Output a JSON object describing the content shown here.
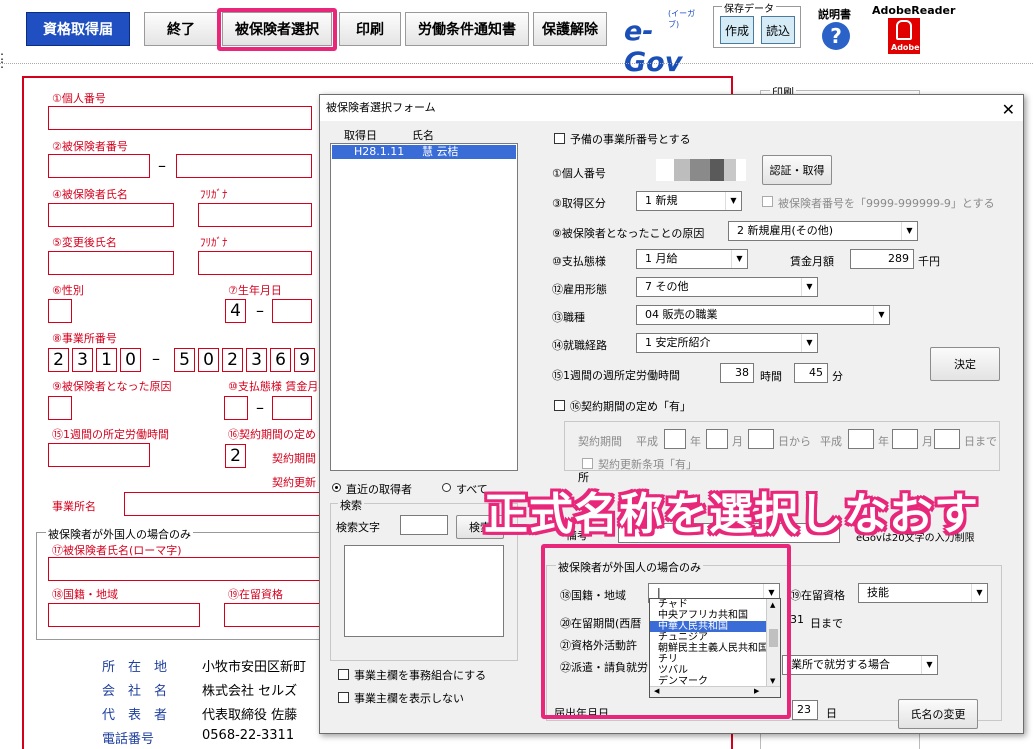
{
  "toolbar": {
    "shikaku": "資格取得届",
    "end": "終了",
    "select_insured": "被保険者選択",
    "print": "印刷",
    "labor_notice": "労働条件通知書",
    "unprotect": "保護解除",
    "egov": "e-Gov",
    "egov_ruby": "(イーガブ)",
    "save_data": "保存データ",
    "create": "作成",
    "read": "読込",
    "manual": "説明書",
    "adobe_reader": "AdobeReader",
    "adobe": "Adobe"
  },
  "form": {
    "l1": "①個人番号",
    "l2": "②被保険者番号",
    "l4": "④被保険者氏名",
    "furigana1": "ﾌﾘｶﾞﾅ",
    "l5": "⑤変更後氏名",
    "furigana2": "ﾌﾘｶﾞﾅ",
    "l6": "⑥性別",
    "l7": "⑦生年月日",
    "birth_era": "4",
    "l8": "⑧事業所番号",
    "office_digits": [
      "2",
      "3",
      "1",
      "0",
      "5",
      "0",
      "2",
      "3",
      "6",
      "9"
    ],
    "l9": "⑨被保険者となった原因",
    "l10": "⑩支払態様 賃金月額",
    "l15": "⑮1週間の所定労働時間",
    "l16": "⑯契約期間の定め",
    "contract_val": "2",
    "contract_period": "契約期間",
    "contract_renew": "契約更新",
    "office_name": "事業所名",
    "foreign_group": "被保険者が外国人の場合のみ",
    "l17": "⑰被保険者氏名(ローマ字)",
    "l18": "⑱国籍・地域",
    "l19": "⑲在留資格",
    "print_group": "印刷",
    "addr_label": "所　在　地",
    "addr_value": "小牧市安田区新町",
    "company_label": "会　社　名",
    "company_value": "株式会社 セルズ",
    "rep_label": "代　表　者",
    "rep_value": "代表取締役 佐藤",
    "tel_label": "電話番号",
    "tel_value": "0568-22-3311"
  },
  "dialog": {
    "title": "被保険者選択フォーム",
    "close": "✕",
    "col_date": "取得日",
    "col_name": "氏名",
    "list_row_date": "H28.1.11",
    "list_row_name": "慧 云桔",
    "radio_recent": "直近の取得者",
    "radio_all": "すべて",
    "search_group": "検索",
    "search_label": "検索文字",
    "search_btn": "検索",
    "chk_union": "事業主欄を事務組合にする",
    "chk_hide": "事業主欄を表示しない",
    "spare_office": "予備の事業所番号とする",
    "f1": "①個人番号",
    "auth_btn": "認証・取得",
    "f3": "③取得区分",
    "f3_val": "1  新規",
    "insured_num_chk": "被保険者番号を「9999-999999-9」とする",
    "f9": "⑨被保険者となったことの原因",
    "f9_val": "2  新規雇用(その他)",
    "f10": "⑩支払態様",
    "f10_val": "1  月給",
    "wage_label": "賃金月額",
    "wage_val": "289",
    "wage_unit": "千円",
    "f12": "⑫雇用形態",
    "f12_val": "7  その他",
    "f13": "⑬職種",
    "f13_val": "04  販売の職業",
    "f14": "⑭就職経路",
    "f14_val": "1  安定所紹介",
    "f15": "⑮1週間の週所定労働時間",
    "hours_val": "38",
    "hours_unit": "時間",
    "min_val": "45",
    "min_unit": "分",
    "decide_btn": "決定",
    "f16": "⑯契約期間の定め「有」",
    "contract_label": "契約期間",
    "heisei1": "平成",
    "year1": "年",
    "month1": "月",
    "day_from": "日から",
    "heisei2": "平成",
    "year2": "年",
    "month2": "月",
    "day_to": "日まで",
    "renew_clause": "契約更新条項「有」",
    "office_label": "所",
    "remarks": "備考",
    "egov_limit": "eGovは20文字の入力制限",
    "foreign_group": "被保険者が外国人の場合のみ",
    "f18": "⑱国籍・地域",
    "f18_val": "|",
    "f19": "⑲在留資格",
    "f19_val": "技能",
    "f20": "⑳在留期間(西暦",
    "f20_day": "31",
    "f20_made": "日まで",
    "f21": "㉑資格外活動許",
    "f22": "㉒派遣・請負就労",
    "f22_val": "業所で就労する場合",
    "notify_date": "届出年月日",
    "notify_day": "23",
    "notify_day_unit": "日",
    "rename_btn": "氏名の変更",
    "dropdown_items": [
      "チャド",
      "中央アフリカ共和国",
      "中華人民共和国",
      "チュニジア",
      "朝鮮民主主義人民共和国",
      "チリ",
      "ツバル",
      "デンマーク"
    ],
    "dropdown_selected_index": 2
  },
  "annotation": "正式名称を選択しなおす",
  "colors": {
    "accent_pink": "#e8267a",
    "form_red": "#d5001c",
    "selection_blue": "#3a6cd8"
  }
}
